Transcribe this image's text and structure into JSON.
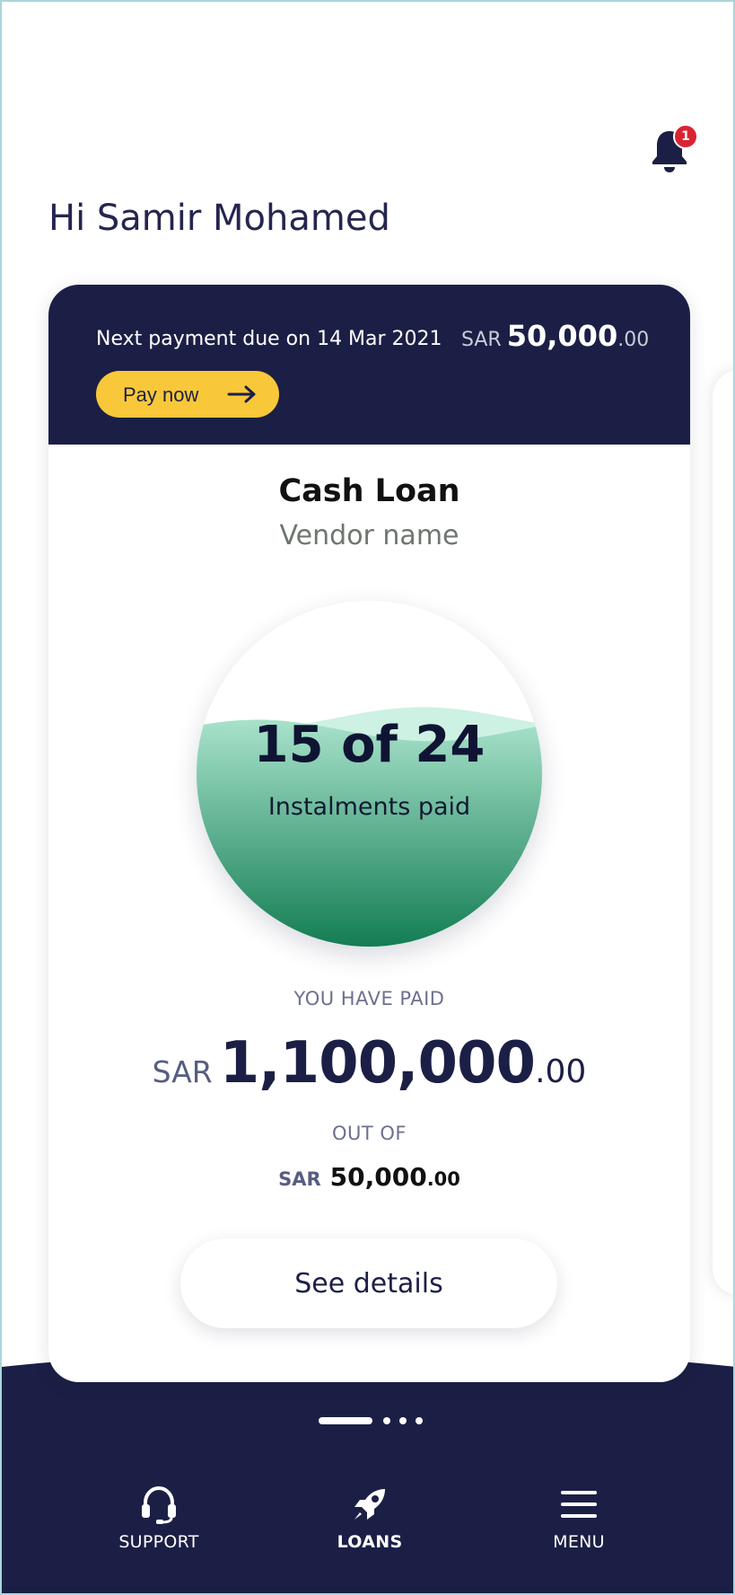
{
  "header": {
    "greeting": "Hi Samir Mohamed",
    "notification_count": "1"
  },
  "loan_card": {
    "due_text": "Next payment due on 14 Mar 2021",
    "due_amount": {
      "currency": "SAR",
      "whole": "50,000",
      "decimals": ".00"
    },
    "pay_button_label": "Pay now",
    "title": "Cash Loan",
    "vendor": "Vendor name",
    "instalments": {
      "summary": "15 of 24",
      "label": "Instalments paid",
      "paid": 15,
      "total": 24
    },
    "paid_label": "YOU HAVE PAID",
    "paid_amount": {
      "currency": "SAR",
      "whole": "1,100,000",
      "decimals": ".00"
    },
    "out_of_label": "OUT OF",
    "total_amount": {
      "currency": "SAR",
      "whole": "50,000",
      "decimals": ".00"
    },
    "details_button_label": "See details"
  },
  "pager": {
    "pages": 4,
    "active": 0
  },
  "bottom_nav": {
    "items": [
      {
        "label": "SUPPORT",
        "icon": "headset-icon",
        "active": false
      },
      {
        "label": "LOANS",
        "icon": "rocket-icon",
        "active": true
      },
      {
        "label": "MENU",
        "icon": "hamburger-menu-icon",
        "active": false
      }
    ]
  },
  "colors": {
    "navy": "#1c1f45",
    "accent_yellow": "#f8c83a",
    "progress_green": "#1b8a5e",
    "badge_red": "#d92332"
  }
}
